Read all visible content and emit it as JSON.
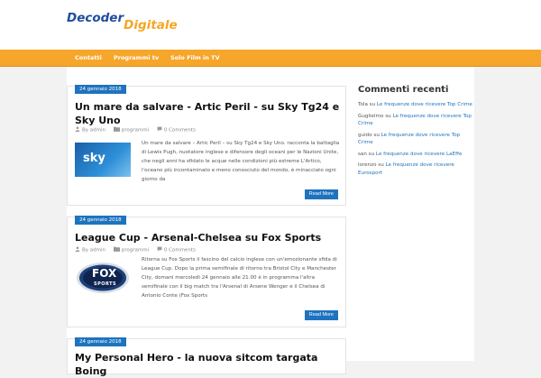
{
  "site": {
    "logo_part1": "Decoder",
    "logo_part2": "Digitale"
  },
  "nav": {
    "items": [
      "Contatti",
      "Programmi tv",
      "Solo Film in TV"
    ]
  },
  "posts": [
    {
      "date": "24 gennaio 2018",
      "title": "Un mare da salvare - Artic Peril - su Sky Tg24 e Sky Uno",
      "meta_author_prefix": "By",
      "author": "admin",
      "category": "programmi",
      "comments": "0 Comments",
      "thumb_label": "sky",
      "excerpt": "Un mare da salvare – Artic Peril – su Sky Tg24 e Sky Uno. racconta la battaglia di Lewis Pugh, nuotatore inglese e difensore degli oceani per le Nazioni Unite, che negli anni ha sfidato le acque nelle condizioni più estreme L'Artico, l'oceano più incontaminato e meno conosciuto del mondo, è minacciato ogni giorno da",
      "read_more": "Read More"
    },
    {
      "date": "24 gennaio 2018",
      "title": "League Cup - Arsenal-Chelsea su Fox Sports",
      "meta_author_prefix": "By",
      "author": "admin",
      "category": "programmi",
      "comments": "0 Comments",
      "thumb_label_line1": "FOX",
      "thumb_label_line2": "SPORTS",
      "excerpt": "Ritorna su Fox Sports il fascino del calcio inglese con un'emozionante sfida di League Cup. Dopo la prima semifinale di ritorno tra Bristol City e Manchester City, domani mercoledì 24 gennaio alle 21.00 è in programma l'altra semifinale con il big match tra l'Arsenal di Arsene Wenger e il Chelsea di Antonio Conte (Fox Sports",
      "read_more": "Read More"
    },
    {
      "date": "24 gennaio 2018",
      "title": "My Personal Hero - la nuova sitcom targata Boing"
    }
  ],
  "sidebar": {
    "title": "Commenti recenti",
    "comments": [
      {
        "author": "Tola",
        "connector": "su",
        "post": "Le frequenze dove ricevere Top Crime"
      },
      {
        "author": "Guglielmo",
        "connector": "su",
        "post": "Le frequenze dove ricevere Top Crime"
      },
      {
        "author": "guido",
        "connector": "su",
        "post": "Le frequenze dove ricevere Top Crime"
      },
      {
        "author": "san",
        "connector": "su",
        "post": "Le frequenze dove ricevere LaEffe"
      },
      {
        "author": "lorenzo",
        "connector": "su",
        "post": "Le frequenze dove ricevere Eurosport"
      }
    ]
  },
  "colors": {
    "brand_blue": "#1e73be",
    "nav_orange": "#f6a62a",
    "logo_blue": "#1f4e9c",
    "logo_orange": "#f5a623"
  },
  "icons": [
    "user-icon",
    "folder-icon",
    "comment-icon"
  ]
}
